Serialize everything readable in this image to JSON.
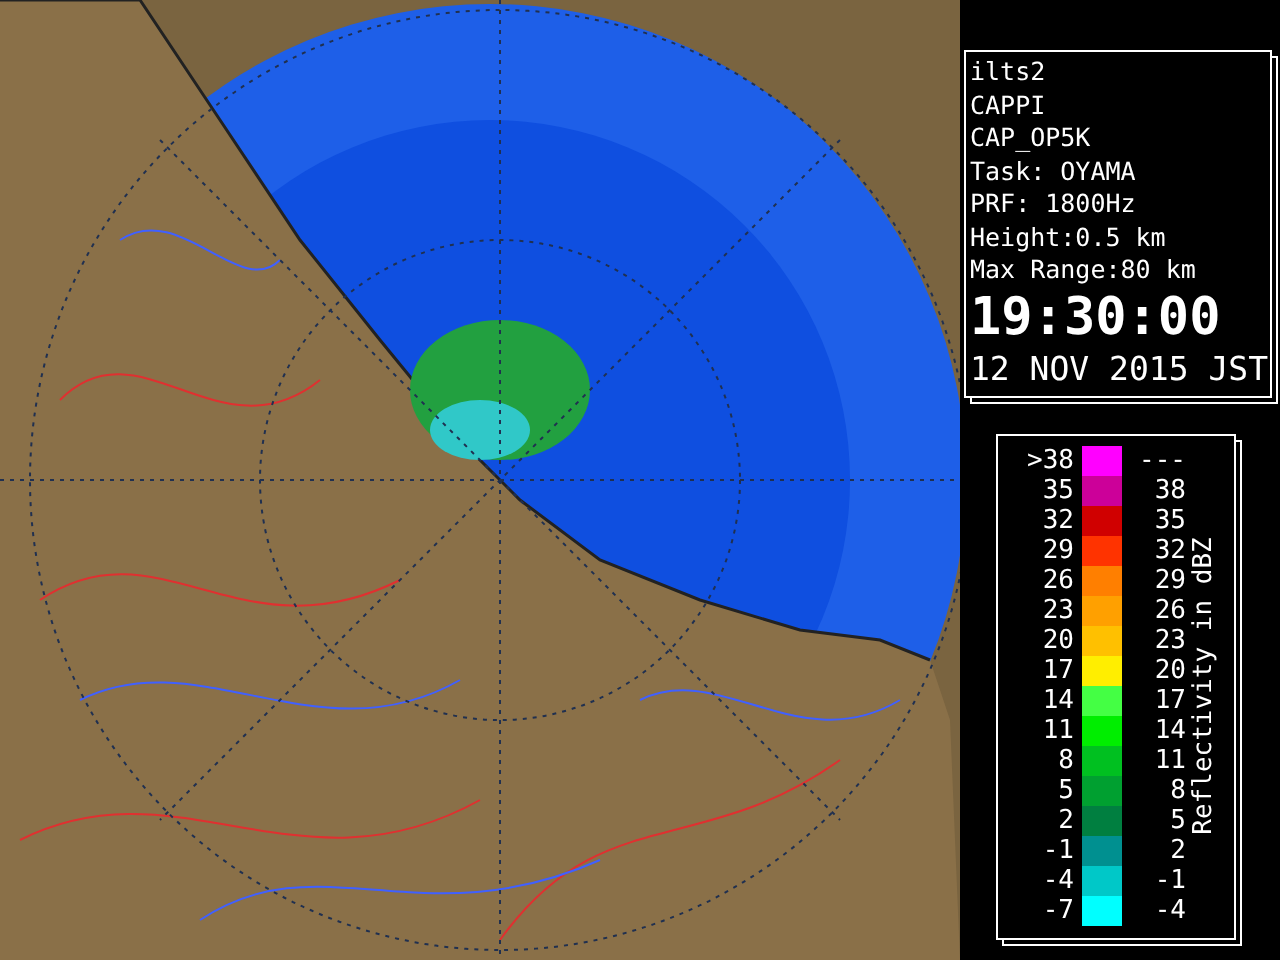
{
  "info": {
    "lines": [
      "ilts2",
      "CAPPI",
      "CAP_OP5K",
      "Task: OYAMA",
      "PRF: 1800Hz",
      "Height:0.5 km",
      "Max Range:80 km"
    ],
    "time": "19:30:00",
    "date": "12 NOV 2015 JST"
  },
  "legend": {
    "title": "Reflectivity in dBZ",
    "rows": [
      {
        "low": ">38",
        "high": "---",
        "color": "#ff00ff"
      },
      {
        "low": "35",
        "high": "38",
        "color": "#cc0099"
      },
      {
        "low": "32",
        "high": "35",
        "color": "#d00000"
      },
      {
        "low": "29",
        "high": "32",
        "color": "#ff3300"
      },
      {
        "low": "26",
        "high": "29",
        "color": "#ff7f00"
      },
      {
        "low": "23",
        "high": "26",
        "color": "#ffa000"
      },
      {
        "low": "20",
        "high": "23",
        "color": "#ffc000"
      },
      {
        "low": "17",
        "high": "20",
        "color": "#ffee00"
      },
      {
        "low": "14",
        "high": "17",
        "color": "#44ff44"
      },
      {
        "low": "11",
        "high": "14",
        "color": "#00ee00"
      },
      {
        "low": "8",
        "high": "11",
        "color": "#00c020"
      },
      {
        "low": "5",
        "high": "8",
        "color": "#00a030"
      },
      {
        "low": "2",
        "high": "5",
        "color": "#007f40"
      },
      {
        "low": "-1",
        "high": "2",
        "color": "#009090"
      },
      {
        "low": "-4",
        "high": "-1",
        "color": "#00c8c8"
      },
      {
        "low": "-7",
        "high": "-4",
        "color": "#00ffff"
      }
    ]
  }
}
